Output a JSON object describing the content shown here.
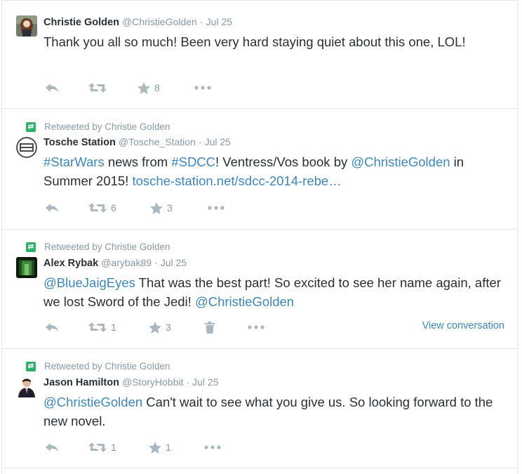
{
  "tweets": [
    {
      "retweeted_by": "",
      "name": "Christie Golden",
      "handle": "@ChristieGolden",
      "time": "Jul 25",
      "text_parts": [
        {
          "t": "Thank you all so much! Been very hard staying quiet about this one, "
        },
        {
          "t": "LOL!"
        }
      ],
      "retweets": "",
      "favorites": "8"
    },
    {
      "retweeted_by": "Retweeted by Christie Golden",
      "name": "Tosche Station",
      "handle": "@Tosche_Station",
      "time": "Jul 25",
      "text_parts": [
        {
          "t": "#StarWars",
          "link": true
        },
        {
          "t": " news from "
        },
        {
          "t": "#SDCC",
          "link": true
        },
        {
          "t": "! Ventress/Vos book by "
        },
        {
          "t": "@ChristieGolden",
          "link": true
        },
        {
          "t": " in Summer 2015! "
        },
        {
          "t": "tosche-station.net/sdcc-2014-rebe…",
          "link": true
        }
      ],
      "retweets": "6",
      "favorites": "3"
    },
    {
      "retweeted_by": "Retweeted by Christie Golden",
      "name": "Alex Rybak",
      "handle": "@arybak89",
      "time": "Jul 25",
      "text_parts": [
        {
          "t": "@BlueJaigEyes",
          "link": true
        },
        {
          "t": " That was the best part! So excited to see her name again, after we lost Sword of the Jedi! "
        },
        {
          "t": "@ChristieGolden",
          "link": true
        }
      ],
      "retweets": "1",
      "favorites": "3",
      "view_conversation": "View conversation"
    },
    {
      "retweeted_by": "Retweeted by Christie Golden",
      "name": "Jason Hamilton",
      "handle": "@StoryHobbit",
      "time": "Jul 25",
      "text_parts": [
        {
          "t": "@ChristieGolden",
          "link": true
        },
        {
          "t": " Can't wait to see what you give us. So looking forward to the new novel."
        }
      ],
      "retweets": "1",
      "favorites": "1"
    }
  ],
  "colors": {
    "link": "#3d86b8",
    "muted": "#8899a6",
    "icon": "#aab8c2",
    "retweet_badge": "#2fb06b"
  },
  "icons": [
    "reply-icon",
    "retweet-icon",
    "favorite-icon",
    "more-icon",
    "delete-icon",
    "retweet-badge-icon"
  ]
}
